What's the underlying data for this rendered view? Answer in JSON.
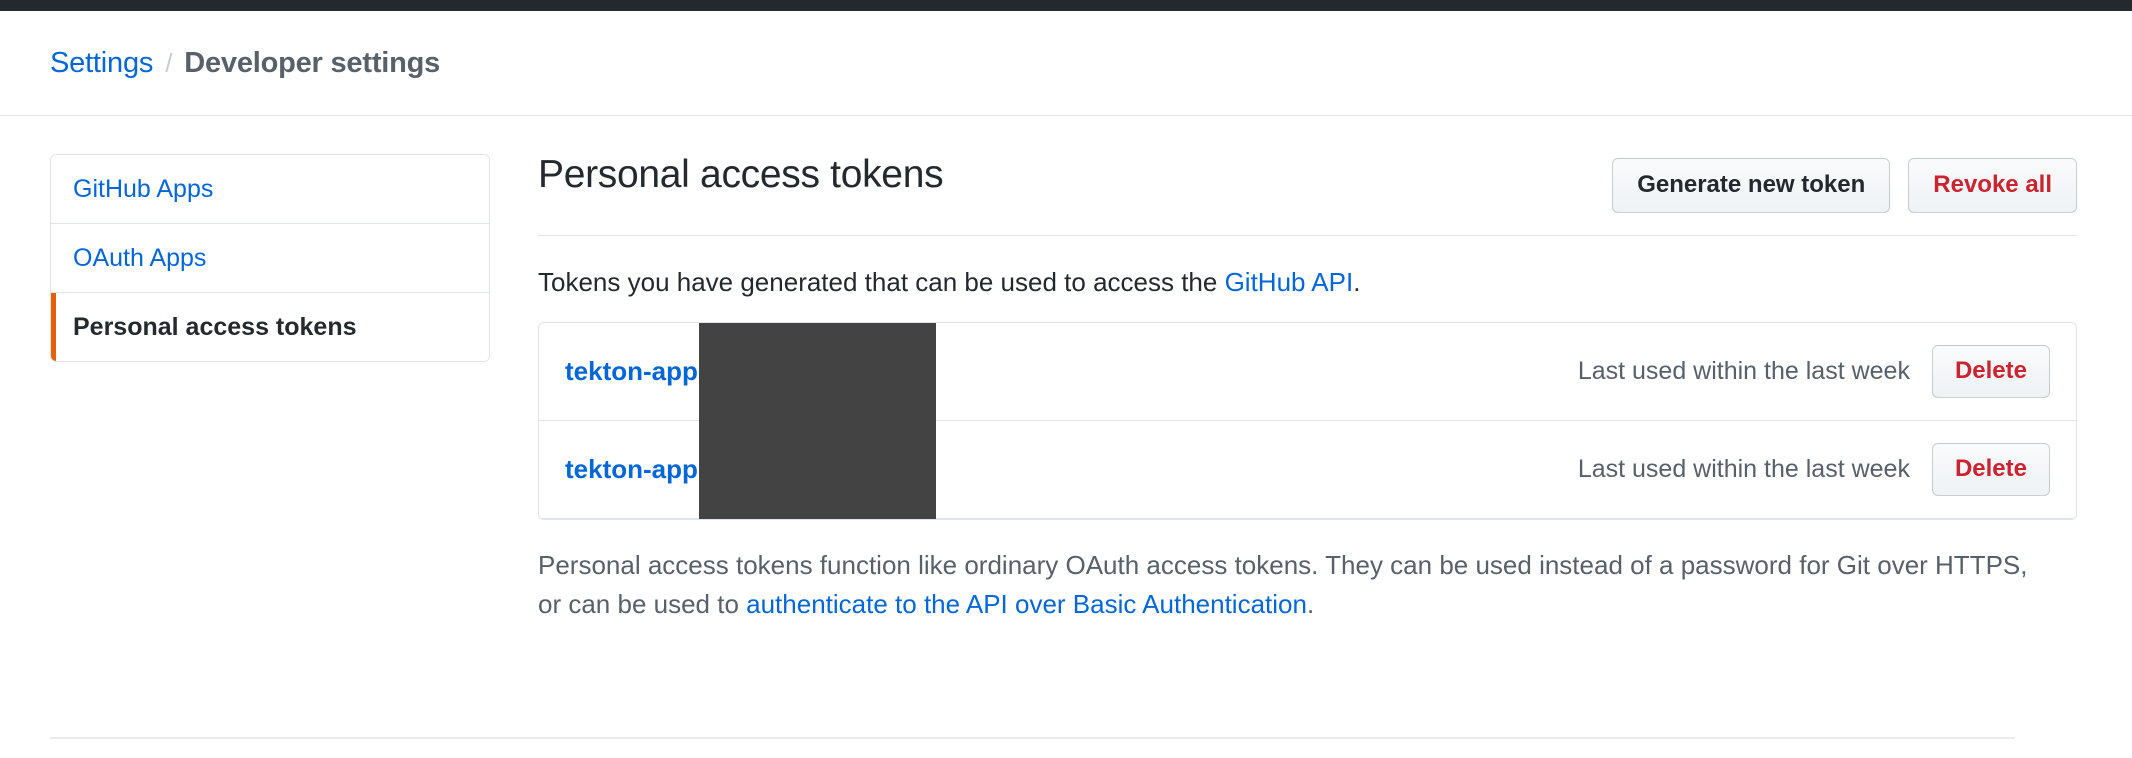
{
  "breadcrumb": {
    "parent": "Settings",
    "separator": "/",
    "current": "Developer settings"
  },
  "sidebar": {
    "items": [
      {
        "label": "GitHub Apps",
        "selected": false
      },
      {
        "label": "OAuth Apps",
        "selected": false
      },
      {
        "label": "Personal access tokens",
        "selected": true
      }
    ]
  },
  "main": {
    "title": "Personal access tokens",
    "actions": {
      "generate_label": "Generate new token",
      "revoke_label": "Revoke all"
    },
    "intro": {
      "text_before": "Tokens you have generated that can be used to access the ",
      "link_label": "GitHub API",
      "text_after": "."
    },
    "tokens": [
      {
        "name": "tekton-app-",
        "last_used": "Last used within the last week",
        "delete_label": "Delete"
      },
      {
        "name": "tekton-app",
        "last_used": "Last used within the last week",
        "delete_label": "Delete"
      }
    ],
    "footnote": {
      "text_before": "Personal access tokens function like ordinary OAuth access tokens. They can be used instead of a password for Git over HTTPS, or can be used to ",
      "link_label": "authenticate to the API over Basic Authentication",
      "text_after": "."
    }
  },
  "colors": {
    "link": "#0366d6",
    "danger": "#cb2431",
    "selected_accent": "#e36209",
    "topbar": "#24292e",
    "redaction": "#434343",
    "border": "#e1e4e8"
  }
}
